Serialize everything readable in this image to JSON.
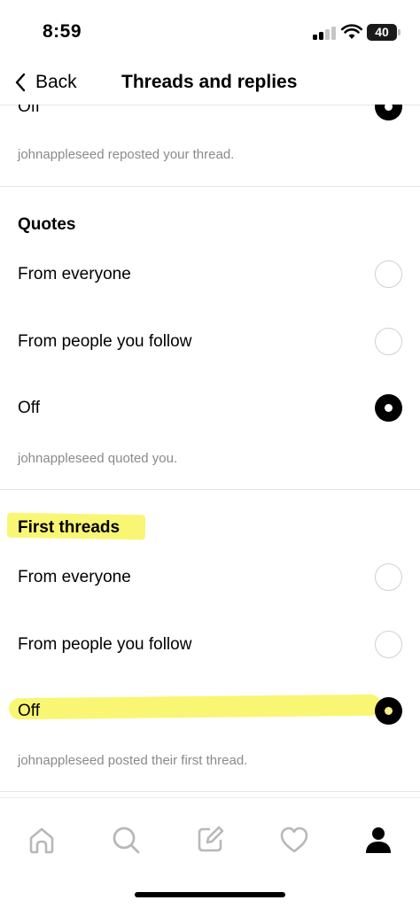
{
  "status_bar": {
    "time": "8:59",
    "battery": "40"
  },
  "header": {
    "back_label": "Back",
    "title": "Threads and replies"
  },
  "prev_section": {
    "option_label_partial": "Off",
    "caption": "johnappleseed reposted your thread."
  },
  "quotes": {
    "title": "Quotes",
    "options": [
      {
        "label": "From everyone",
        "selected": false
      },
      {
        "label": "From people you follow",
        "selected": false
      },
      {
        "label": "Off",
        "selected": true
      }
    ],
    "caption": "johnappleseed quoted you."
  },
  "first_threads": {
    "title": "First threads",
    "options": [
      {
        "label": "From everyone",
        "selected": false
      },
      {
        "label": "From people you follow",
        "selected": false
      },
      {
        "label": "Off",
        "selected": true
      }
    ],
    "caption": "johnappleseed posted their first thread."
  },
  "tab_bar": {
    "tabs": [
      {
        "icon": "home-icon",
        "active": false
      },
      {
        "icon": "search-icon",
        "active": false
      },
      {
        "icon": "compose-icon",
        "active": false
      },
      {
        "icon": "heart-icon",
        "active": false
      },
      {
        "icon": "profile-icon",
        "active": true
      }
    ]
  },
  "colors": {
    "highlight": "#f8f55a",
    "divider": "#e6e6e6",
    "caption": "#8a8a8a",
    "inactive_icon": "#b8b8b8"
  }
}
